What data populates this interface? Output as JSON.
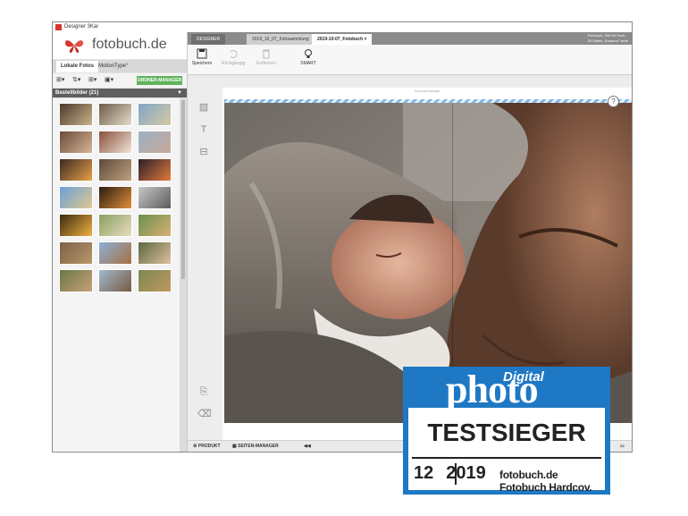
{
  "window": {
    "title": "Designer 3Kal"
  },
  "logo": {
    "text": "fotobuch.de"
  },
  "left_tabs": [
    {
      "label": "Lokale Fotos"
    },
    {
      "label": "MotionType°"
    }
  ],
  "ordner_button": "ORDNER-MANAGER",
  "section": {
    "label": "Bestellbilder (21)",
    "arrow": "▼"
  },
  "thumbnails": [
    {
      "c1": "#4a3a2a",
      "c2": "#c9b38a"
    },
    {
      "c1": "#6d5a48",
      "c2": "#e6dccb"
    },
    {
      "c1": "#7fa6c6",
      "c2": "#d8c9a6"
    },
    {
      "c1": "#6b4a3a",
      "c2": "#d7b596"
    },
    {
      "c1": "#8a4f3a",
      "c2": "#f1e4d8"
    },
    {
      "c1": "#9bb1c3",
      "c2": "#c7a89a"
    },
    {
      "c1": "#3a2a20",
      "c2": "#e8a04a"
    },
    {
      "c1": "#5d4a3a",
      "c2": "#c0a080"
    },
    {
      "c1": "#2b1f2a",
      "c2": "#e07a3a"
    },
    {
      "c1": "#6aa0d6",
      "c2": "#e0c890"
    },
    {
      "c1": "#2a1a10",
      "c2": "#e0903a"
    },
    {
      "c1": "#c8c8c8",
      "c2": "#5b5b5b"
    },
    {
      "c1": "#3a2a10",
      "c2": "#f0b040"
    },
    {
      "c1": "#8aa060",
      "c2": "#e8dcc0"
    },
    {
      "c1": "#6a9050",
      "c2": "#d8b070"
    },
    {
      "c1": "#7a6048",
      "c2": "#b89868"
    },
    {
      "c1": "#8ab0d8",
      "c2": "#a87040"
    },
    {
      "c1": "#5a6840",
      "c2": "#e0c0a0"
    },
    {
      "c1": "#6a7848",
      "c2": "#c8a078"
    },
    {
      "c1": "#a0b8d0",
      "c2": "#7a5a40"
    },
    {
      "c1": "#7a8850",
      "c2": "#c09860"
    }
  ],
  "top_tabs": {
    "designer": "DESIGNER",
    "tab1": "2019_10_07_Fotosammlung",
    "tab2": "2019-10-07_Fotobuch",
    "close": "×"
  },
  "top_info": {
    "line1": "Fotobuch, DIN A4 Hoch,",
    "line2": "26 Seiten, Romanu° seite"
  },
  "ribbon": [
    {
      "label": "Speichern",
      "icon": "save-icon",
      "enabled": true
    },
    {
      "label": "Rückgängig",
      "icon": "undo-icon",
      "enabled": false
    },
    {
      "label": "Entfernen",
      "icon": "delete-icon",
      "enabled": false
    },
    {
      "label": "SMART",
      "icon": "lightbulb-icon",
      "enabled": true
    }
  ],
  "page_header": "Zwischenablage",
  "bottom": {
    "produkt": "PRODUKT",
    "seiten": "SEITEN-MANAGER",
    "nav": "◀◀"
  },
  "badge": {
    "digital": "Digital",
    "photo": "photo",
    "title": "TESTSIEGER",
    "month": "12",
    "year": "2019",
    "product": "fotobuch.de Fotobuch Hardcov."
  },
  "colors": {
    "badge_blue": "#1f78c4",
    "ordner_green": "#5fb35b",
    "logo_red": "#d9362b",
    "selection_blue": "#7fb7e6"
  }
}
